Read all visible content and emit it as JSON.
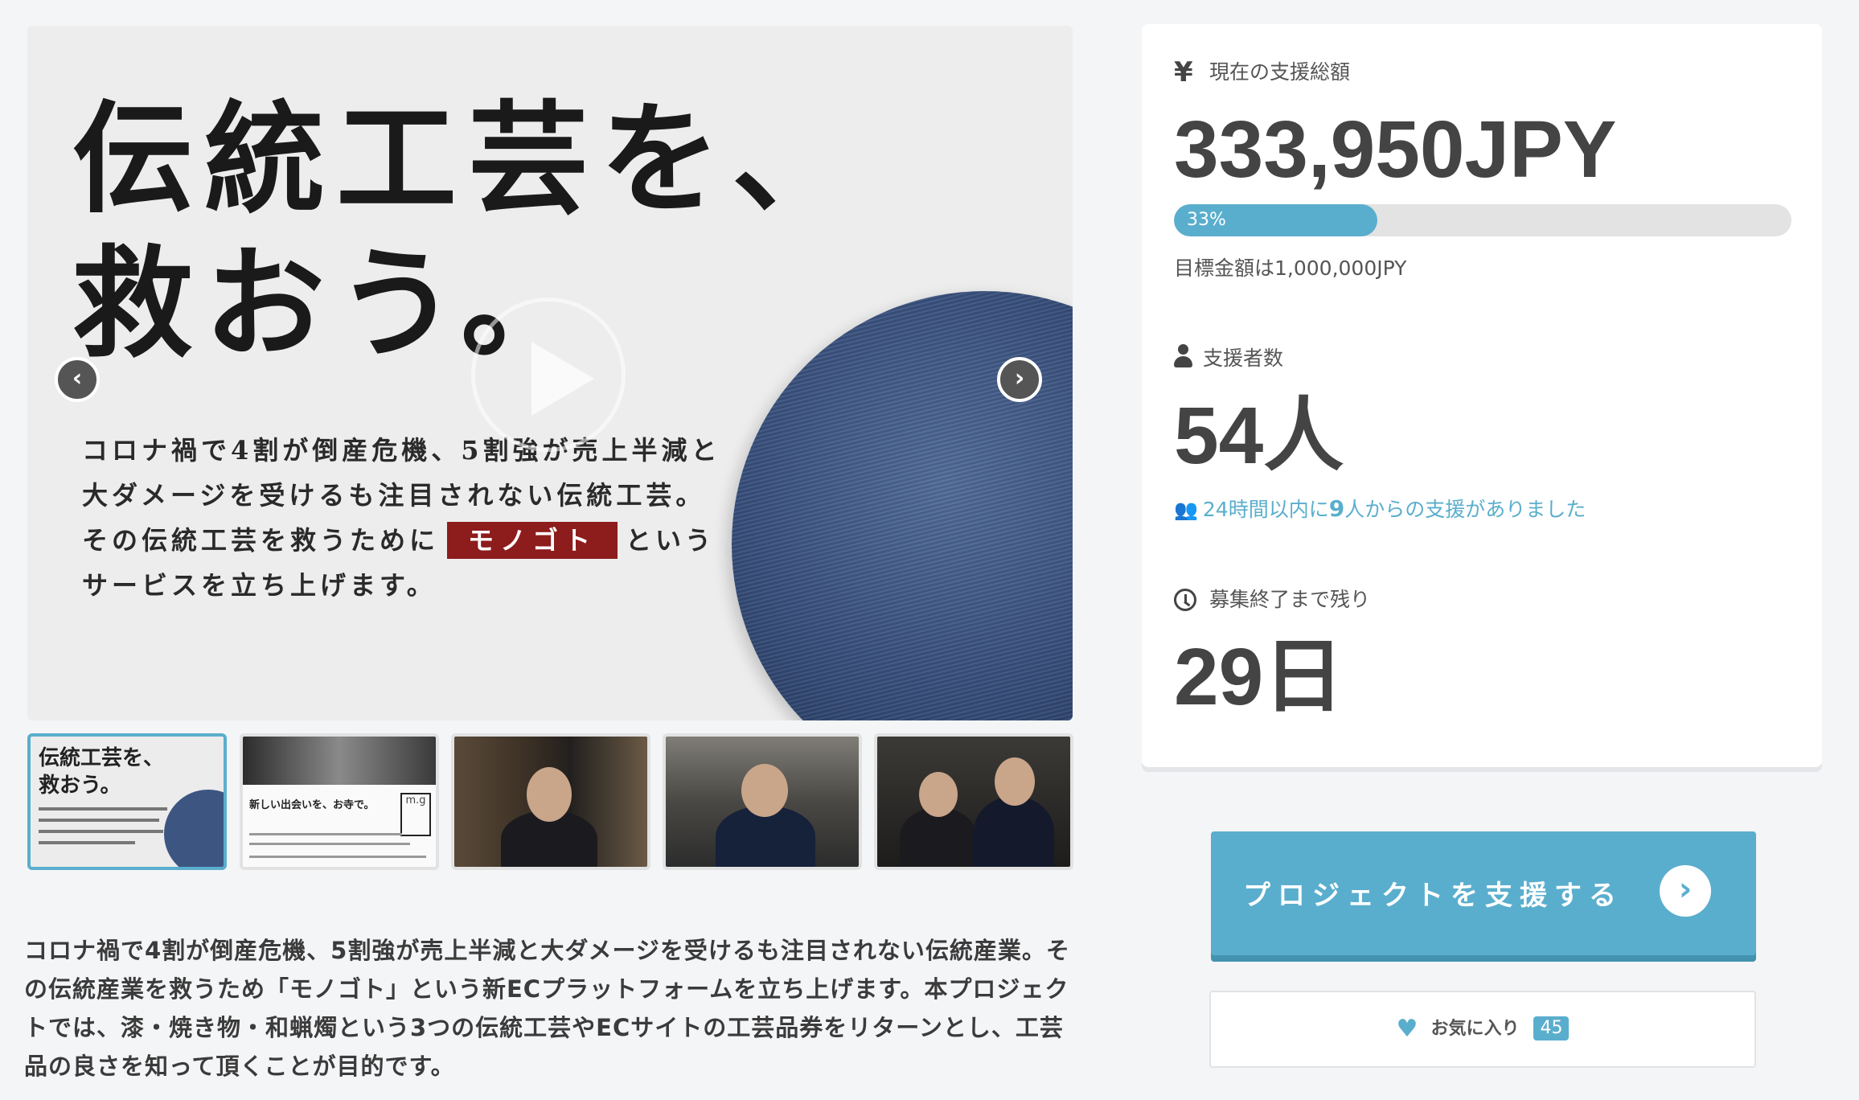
{
  "hero": {
    "title_line1": "伝統工芸を、",
    "title_line2": "救おう。",
    "body_line1": "コロナ禍で4割が倒産危機、5割強が売上半減と",
    "body_line2": "大ダメージを受けるも注目されない伝統工芸。",
    "body_line3_before": "その伝統工芸を救うために",
    "body_line3_tag": "モノゴト",
    "body_line3_after": "という",
    "body_line4": "サービスを立ち上げます。",
    "prev_icon": "chevron-left-icon",
    "next_icon": "chevron-right-icon",
    "play_icon": "play-icon"
  },
  "thumbnails": [
    {
      "text": "伝統工芸を、\n救おう。",
      "active": true
    },
    {
      "text": "新しい出会いを、お寺で。",
      "logo": "m.g",
      "active": false
    },
    {
      "active": false
    },
    {
      "active": false
    },
    {
      "active": false
    }
  ],
  "description": "コロナ禍で4割が倒産危機、5割強が売上半減と大ダメージを受けるも注目されない伝統産業。その伝統産業を救うため「モノゴト」という新ECプラットフォームを立ち上げます。本プロジェクトでは、漆・焼き物・和蝋燭という3つの伝統工芸やECサイトの工芸品券をリターンとし、工芸品の良さを知って頂くことが目的です。",
  "stats": {
    "funding_label": "現在の支援総額",
    "funding_icon": "yen-icon",
    "funding_amount": "333,950JPY",
    "progress_percent": 33,
    "progress_label": "33%",
    "goal_text": "目標金額は1,000,000JPY",
    "backers_label": "支援者数",
    "backers_icon": "person-icon",
    "backers_count": "54人",
    "recent_prefix": "24時間以内に",
    "recent_count": "9",
    "recent_suffix": "人からの支援がありました",
    "remaining_label": "募集終了まで残り",
    "remaining_icon": "clock-icon",
    "remaining_days": "29日"
  },
  "actions": {
    "support_label": "プロジェクトを支援する",
    "favorite_label": "お気に入り",
    "favorite_count": "45"
  },
  "colors": {
    "accent": "#5aaecd",
    "brand_tag": "#8d1c1c",
    "plate": "#3b5380"
  }
}
